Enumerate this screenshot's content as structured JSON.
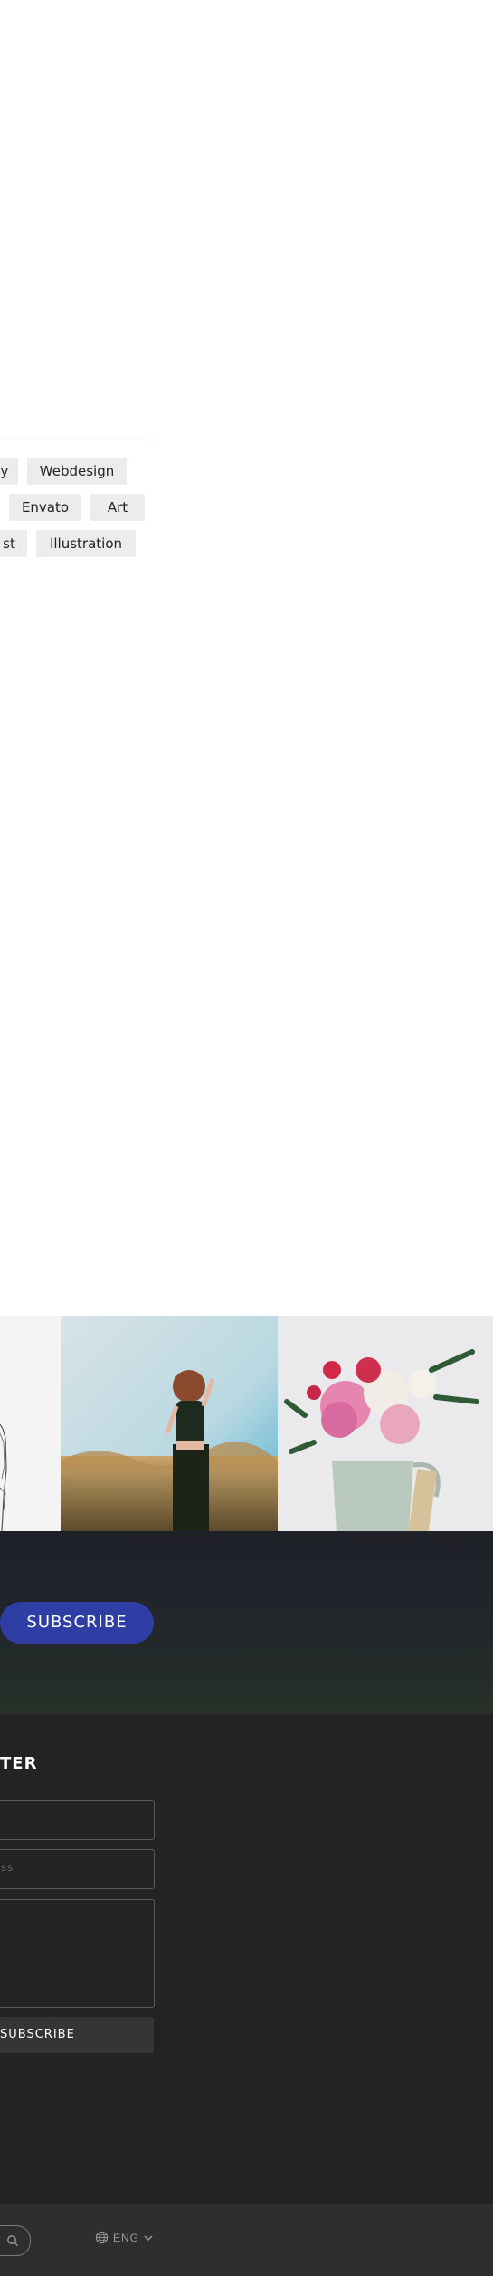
{
  "tags": {
    "row1": [
      "y",
      "Webdesign"
    ],
    "row2": [
      "Envato",
      "Art"
    ],
    "row3": [
      "st",
      "Illustration"
    ]
  },
  "instagram": {
    "tiles": [
      "sketch-image",
      "woman-in-wheat-field-image",
      "flowers-in-vase-image"
    ]
  },
  "subscribe_band": {
    "button_label": "SUBSCRIBE"
  },
  "footer": {
    "newsletter_title": "TER",
    "name_field_placeholder": "",
    "email_field_placeholder": "ss",
    "message_field_placeholder": "",
    "submit_label": "SUBSCRIBE"
  },
  "bottom_bar": {
    "language": "ENG"
  },
  "colors": {
    "accent": "#2f3ea5",
    "footer_bg": "#232323",
    "bottom_bg": "#2e2e2e",
    "tag_bg": "#ececec"
  }
}
